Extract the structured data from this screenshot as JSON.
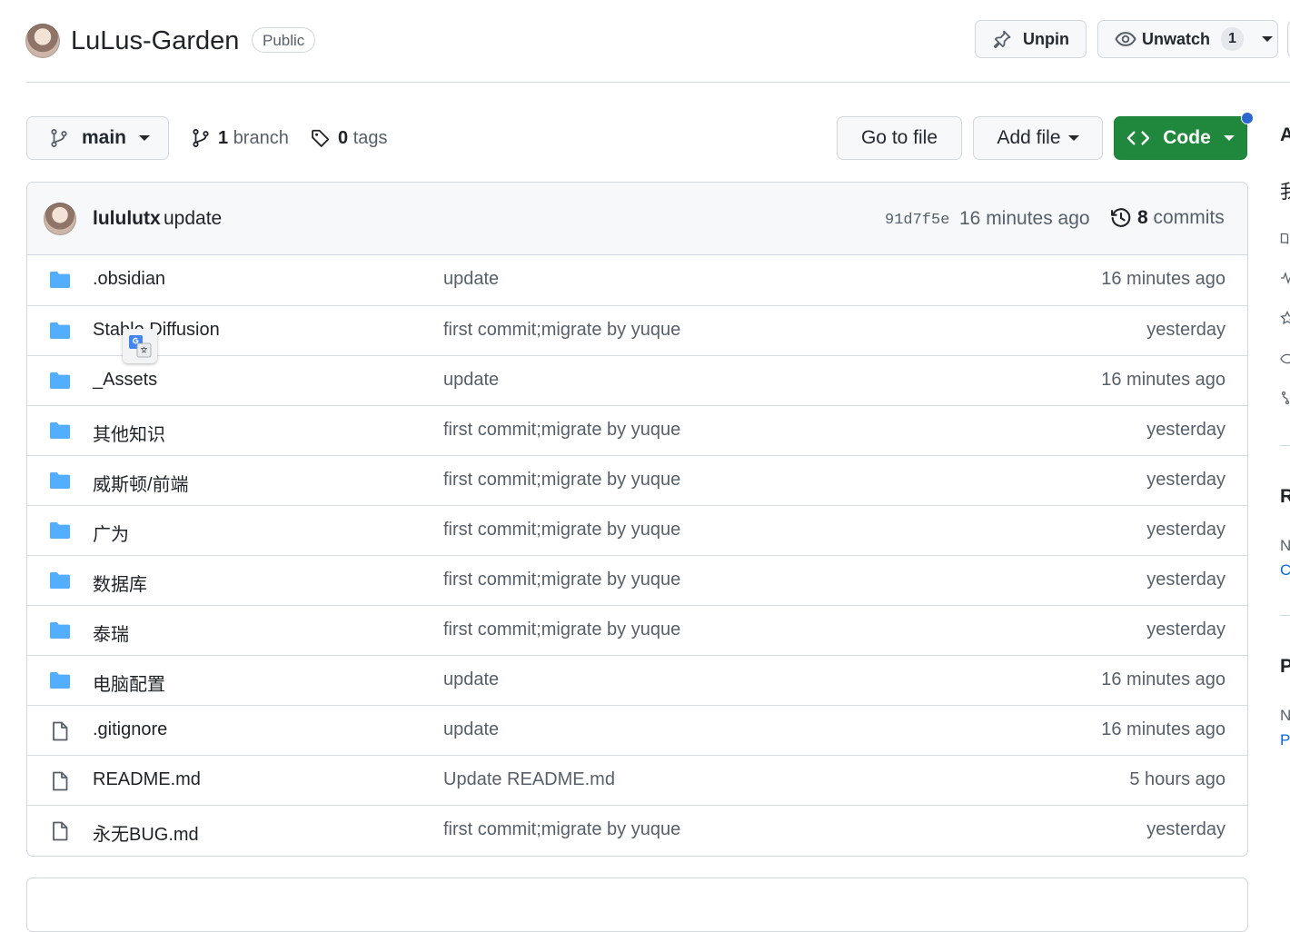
{
  "repo": {
    "name": "LuLus-Garden",
    "visibility": "Public"
  },
  "actions": {
    "unpin": "Unpin",
    "unwatch": "Unwatch",
    "watch_count": "1"
  },
  "toolbar": {
    "branch": "main",
    "branch_count": "1",
    "branch_label": "branch",
    "tag_count": "0",
    "tag_label": "tags",
    "go_to_file": "Go to file",
    "add_file": "Add file",
    "code": "Code"
  },
  "commit": {
    "author": "lululutx",
    "message": "update",
    "sha": "91d7f5e",
    "time": "16 minutes ago",
    "commit_count": "8",
    "commits_label": "commits"
  },
  "files": [
    {
      "type": "folder",
      "name": ".obsidian",
      "message": "update",
      "age": "16 minutes ago"
    },
    {
      "type": "folder",
      "name": "Stable Diffusion",
      "message": "first commit;migrate by yuque",
      "age": "yesterday"
    },
    {
      "type": "folder",
      "name": "_Assets",
      "message": "update",
      "age": "16 minutes ago"
    },
    {
      "type": "folder",
      "name": "其他知识",
      "message": "first commit;migrate by yuque",
      "age": "yesterday"
    },
    {
      "type": "folder",
      "name": "威斯顿/前端",
      "message": "first commit;migrate by yuque",
      "age": "yesterday"
    },
    {
      "type": "folder",
      "name": "广为",
      "message": "first commit;migrate by yuque",
      "age": "yesterday"
    },
    {
      "type": "folder",
      "name": "数据库",
      "message": "first commit;migrate by yuque",
      "age": "yesterday"
    },
    {
      "type": "folder",
      "name": "泰瑞",
      "message": "first commit;migrate by yuque",
      "age": "yesterday"
    },
    {
      "type": "folder",
      "name": "电脑配置",
      "message": "update",
      "age": "16 minutes ago"
    },
    {
      "type": "file",
      "name": ".gitignore",
      "message": "update",
      "age": "16 minutes ago"
    },
    {
      "type": "file",
      "name": "README.md",
      "message": "Update README.md",
      "age": "5 hours ago"
    },
    {
      "type": "file",
      "name": "永无BUG.md",
      "message": "first commit;migrate by yuque",
      "age": "yesterday"
    }
  ],
  "sidebar": {
    "about_initial": "A",
    "desc_initial": "我",
    "releases_initial": "R",
    "releases_text_initial": "N",
    "releases_link_initial": "C",
    "packages_initial": "P",
    "packages_text_initial": "N",
    "packages_link_initial": "P"
  },
  "icons": {
    "folder": "folder-icon",
    "file": "file-icon",
    "branch": "git-branch-icon",
    "tag": "tag-icon",
    "history": "history-icon",
    "pin": "pin-icon",
    "eye": "eye-icon",
    "code": "code-icon",
    "translate": "google-translate-icon"
  },
  "colors": {
    "folder": "#54aeff",
    "code_button": "#1f883d",
    "notification_dot": "#2b67ce",
    "link": "#0969da"
  }
}
